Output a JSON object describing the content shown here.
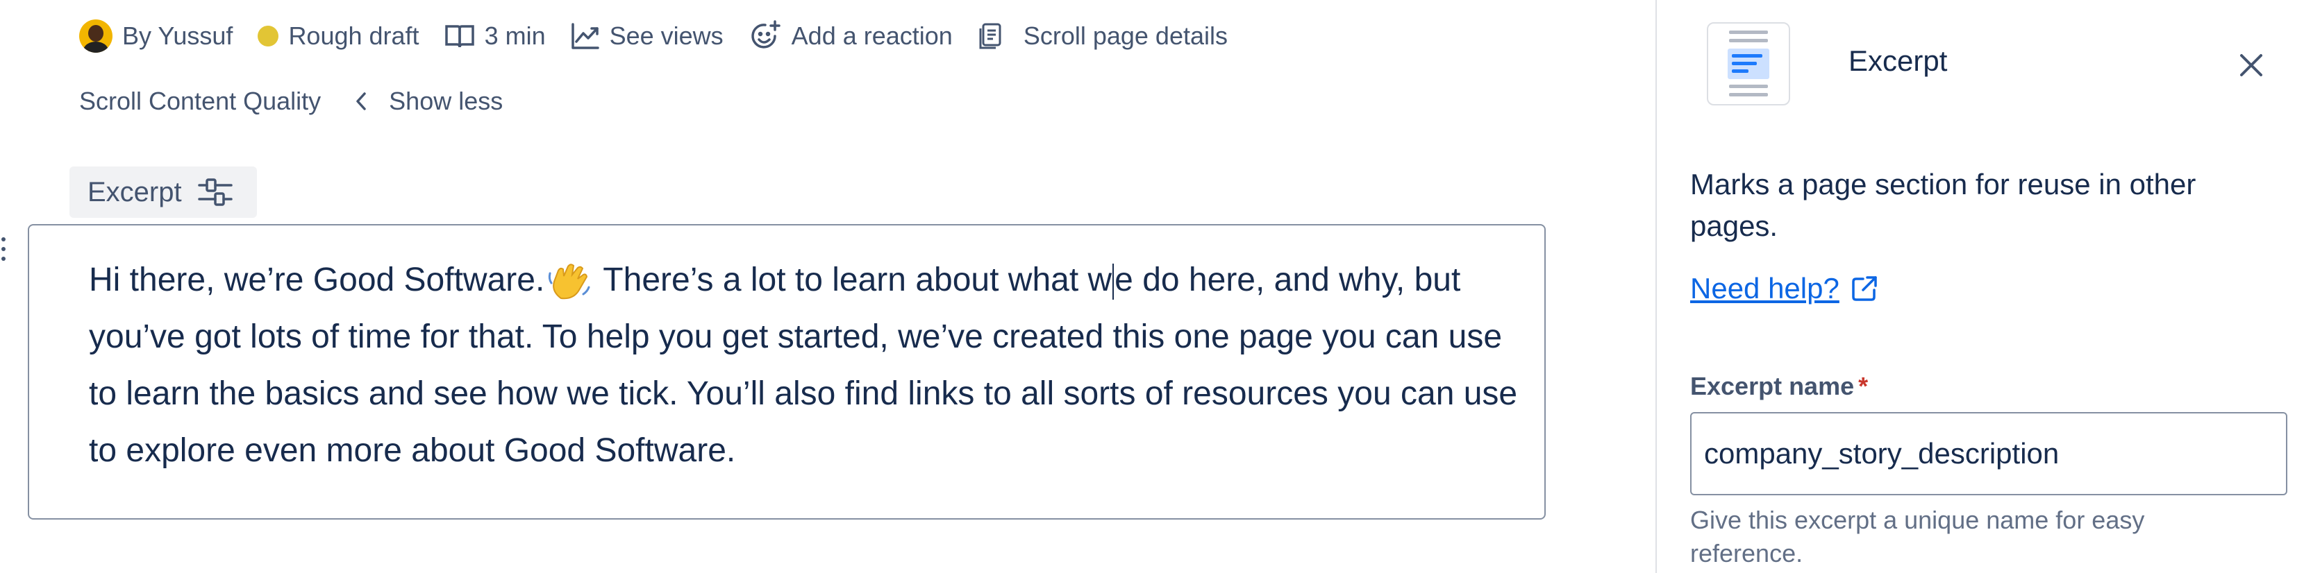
{
  "byline": {
    "author": "By Yussuf",
    "status": "Rough draft",
    "read_time": "3 min",
    "views": "See views",
    "reaction": "Add a reaction",
    "page_details": "Scroll page details"
  },
  "row2": {
    "quality": "Scroll Content Quality",
    "show_less": "Show less"
  },
  "excerpt_chip": {
    "label": "Excerpt"
  },
  "excerpt": {
    "text_before_emoji": "Hi there, we’re Good Software.",
    "text_after_emoji_a": "There’s a lot to learn about what w",
    "text_after_emoji_b": "e do here, and why, but you’ve got lots of time for that. To help you get started, we’ve created this one page you can use to learn the basics and see how we tick. You’ll also find links to all sorts of resources you can use to explore even more about Good Software."
  },
  "panel": {
    "title": "Excerpt",
    "description": "Marks a page section for reuse in other pages.",
    "help_link": "Need help?",
    "field_label": "Excerpt name",
    "required_mark": "*",
    "field_value": "company_story_description",
    "hint": "Give this excerpt a unique name for easy reference."
  },
  "colors": {
    "status_dot": "#e2c535",
    "link": "#0c66e4",
    "required": "#c9372c",
    "panel_icon_accent": "#1d7afc"
  },
  "icons": [
    "avatar",
    "status-dot-icon",
    "book-icon",
    "chart-line-icon",
    "emoji-add-icon",
    "page-details-icon",
    "chevron-left-icon",
    "settings-sliders-icon",
    "drag-handle-icon",
    "waving-hand-icon",
    "excerpt-macro-icon",
    "close-icon",
    "external-link-icon"
  ]
}
